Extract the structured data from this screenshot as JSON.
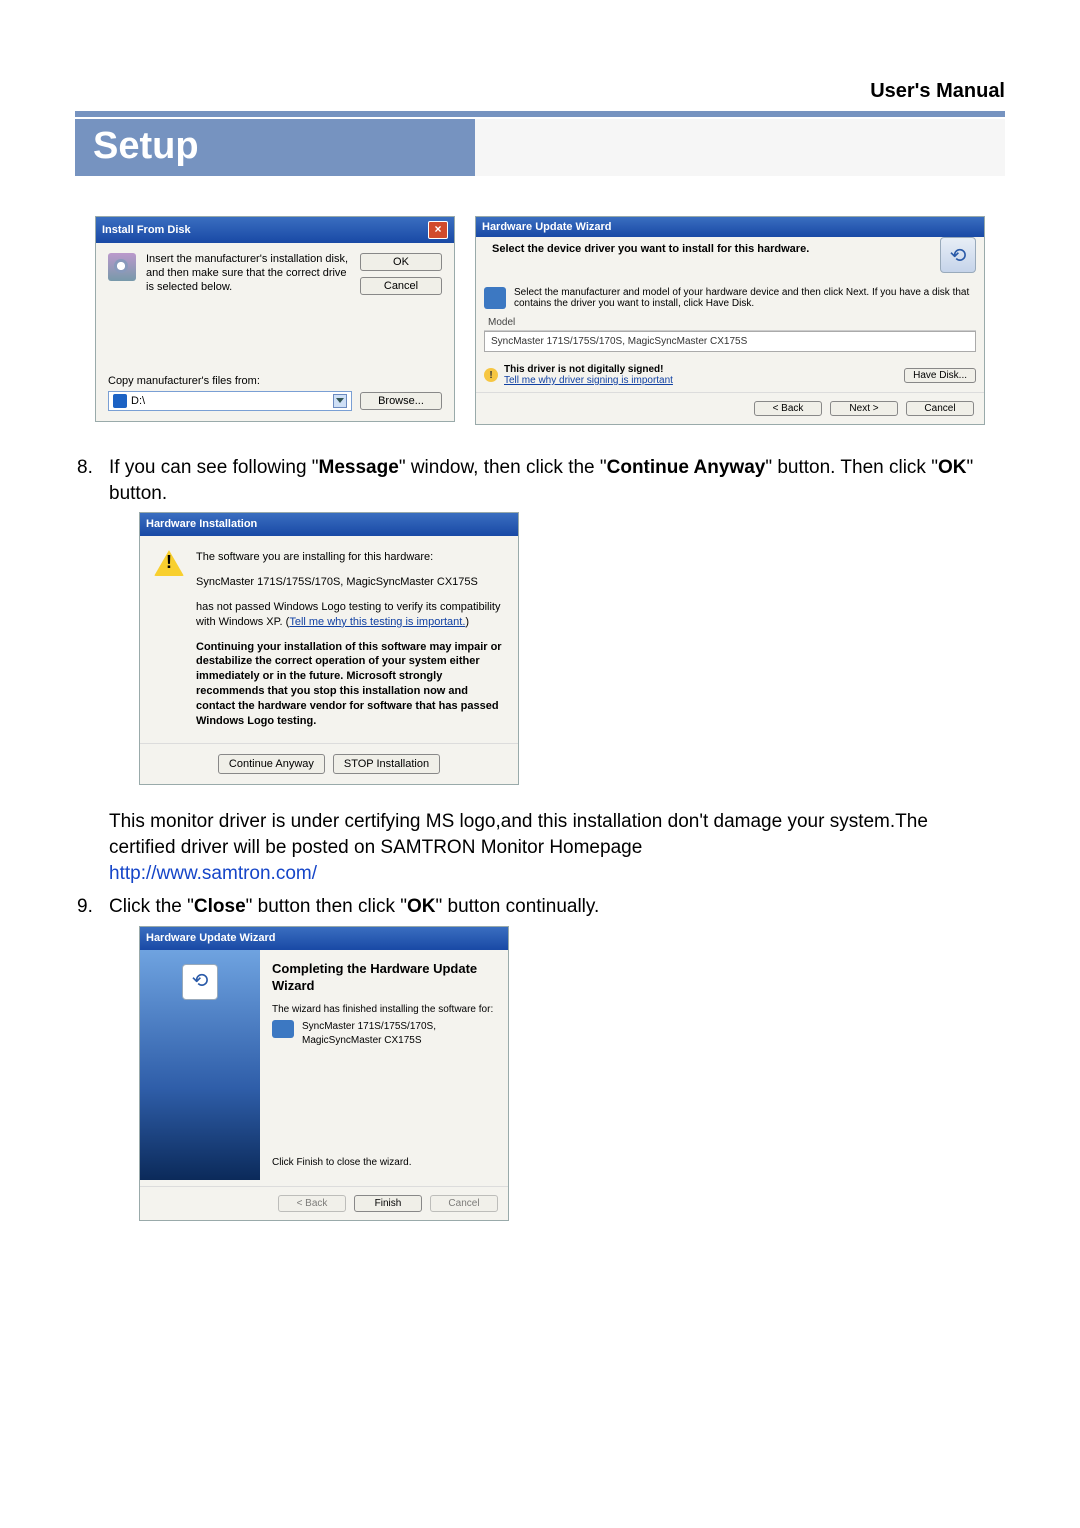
{
  "page": {
    "manual_title": "User's Manual",
    "section_title": "Setup"
  },
  "install_from_disk": {
    "title": "Install From Disk",
    "instruction": "Insert the manufacturer's installation disk, and then make sure that the correct drive is selected below.",
    "ok": "OK",
    "cancel": "Cancel",
    "copy_label": "Copy manufacturer's files from:",
    "drive_value": "D:\\",
    "browse": "Browse..."
  },
  "hw_wizard_select": {
    "title": "Hardware Update Wizard",
    "heading": "Select the device driver you want to install for this hardware.",
    "instruction": "Select the manufacturer and model of your hardware device and then click Next. If you have a disk that contains the driver you want to install, click Have Disk.",
    "model_label": "Model",
    "model_value": "SyncMaster 171S/175S/170S, MagicSyncMaster CX175S",
    "not_signed": "This driver is not digitally signed!",
    "why_link": "Tell me why driver signing is important",
    "have_disk": "Have Disk...",
    "back": "< Back",
    "next": "Next >",
    "cancel": "Cancel"
  },
  "steps": {
    "s8_a": "If you can see following \"",
    "s8_b": "Message",
    "s8_c": "\" window, then click the \"",
    "s8_d": "Continue Anyway",
    "s8_e": "\" button. Then click \"",
    "s8_f": "OK",
    "s8_g": "\" button.",
    "s9_a": "Click the \"",
    "s9_b": "Close",
    "s9_c": "\" button then click \"",
    "s9_d": "OK",
    "s9_e": "\" button continually."
  },
  "hw_installation": {
    "title": "Hardware Installation",
    "line1": "The software you are installing for this hardware:",
    "line2": "SyncMaster 171S/175S/170S, MagicSyncMaster CX175S",
    "line3a": "has not passed Windows Logo testing to verify its compatibility with Windows XP. (",
    "line3_link": "Tell me why this testing is important.",
    "line3b": ")",
    "bold_warn": "Continuing your installation of this software may impair or destabilize the correct operation of your system either immediately or in the future. Microsoft strongly recommends that you stop this installation now and contact the hardware vendor for software that has passed Windows Logo testing.",
    "continue": "Continue Anyway",
    "stop": "STOP Installation"
  },
  "cert_text": {
    "body": "This monitor driver is under certifying MS logo,and this installation don't damage your system.The certified driver will be posted on SAMTRON Monitor Homepage",
    "url": "http://www.samtron.com/"
  },
  "hw_complete": {
    "title": "Hardware Update Wizard",
    "heading": "Completing the Hardware Update Wizard",
    "finished_for": "The wizard has finished installing the software for:",
    "device": "SyncMaster 171S/175S/170S, MagicSyncMaster CX175S",
    "click_finish": "Click Finish to close the wizard.",
    "back": "< Back",
    "finish": "Finish",
    "cancel": "Cancel"
  }
}
